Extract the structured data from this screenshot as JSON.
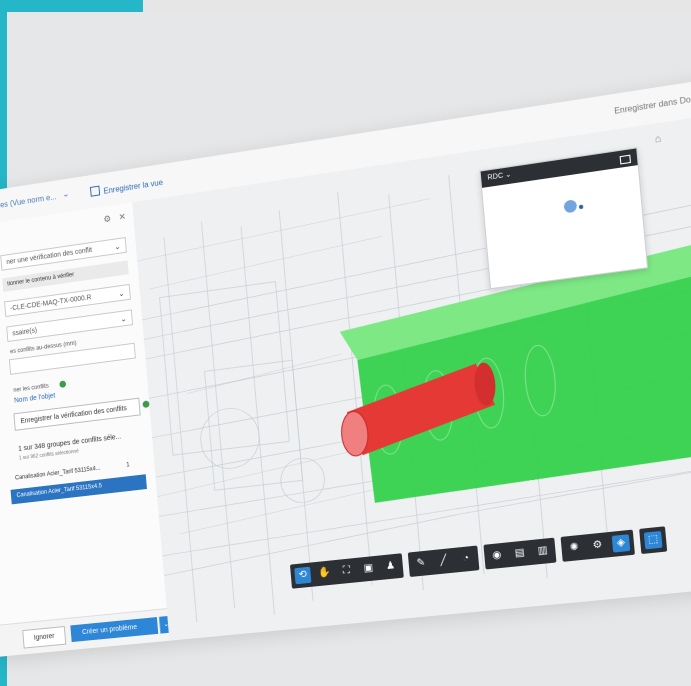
{
  "topbar": {
    "breadcrumb": "des (Vue norm e...",
    "save_view": "Enregistrer la vue",
    "save_docs": "Enregistrer dans Doc"
  },
  "panel": {
    "select_check": "ner une vérification des conflit",
    "content_label": "tionner le contenu à vérifier",
    "model_select": "-CLE-CDE-MAQ-TX-0000.R",
    "type_select": "ssaire(s)",
    "tolerance_label": "es conflits au-dessus (mm)",
    "group_label": "ner les conflits",
    "group_link": "Nom de l'objet",
    "save_check": "Enregistrer la vérification des conflits",
    "summary_title": "1 sur 348 groupes de conflits séle...",
    "summary_sub": "1 sur 962 conflits sélectionné",
    "rows": [
      {
        "label": "Canalisation Acier_Tarif 53115x4...",
        "count": "1"
      },
      {
        "label": "Canalisation Acier_Tarif 53115x4.5",
        "count": ""
      }
    ],
    "btn_ignore": "Ignorer",
    "btn_create": "Créer un problème"
  },
  "minimap": {
    "title": "RDC"
  },
  "colors": {
    "accent": "#25b6c8",
    "clash_pipe": "#e53935",
    "clash_box": "#34d14b",
    "primary": "#2d86d6"
  }
}
